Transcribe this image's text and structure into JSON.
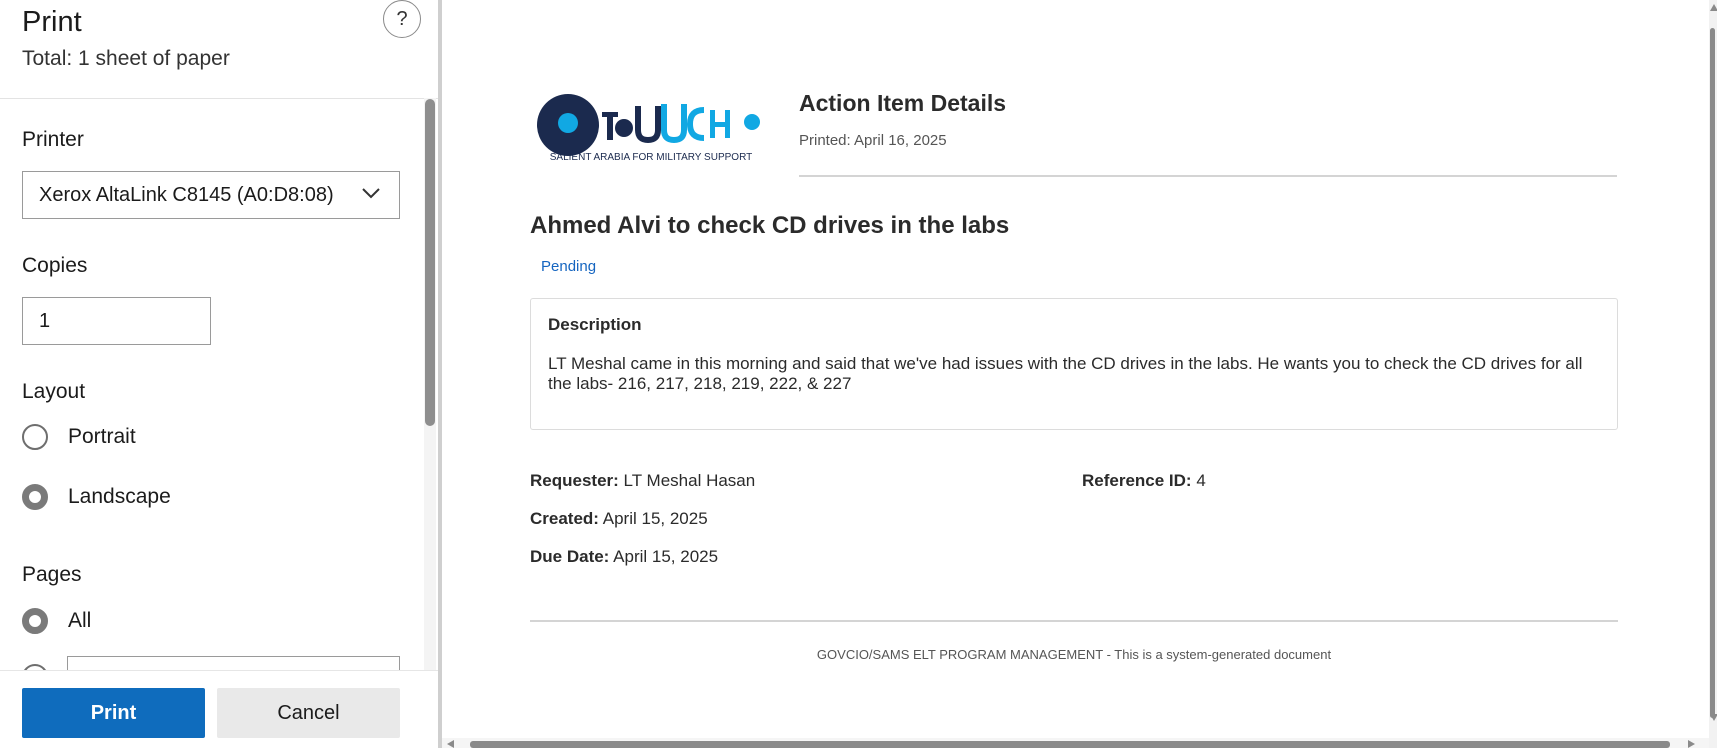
{
  "panel": {
    "title": "Print",
    "total": "Total: 1 sheet of paper",
    "help_glyph": "?",
    "printer": {
      "label": "Printer",
      "value": "Xerox AltaLink C8145 (A0:D8:08)"
    },
    "copies": {
      "label": "Copies",
      "value": "1"
    },
    "layout": {
      "label": "Layout",
      "options": [
        "Portrait",
        "Landscape"
      ],
      "selected": "Landscape"
    },
    "pages": {
      "label": "Pages",
      "options": [
        "All"
      ],
      "selected": "All"
    },
    "buttons": {
      "print": "Print",
      "cancel": "Cancel"
    }
  },
  "document": {
    "logo_caption": "SALIENT ARABIA FOR MILITARY SUPPORT",
    "header_title": "Action Item Details",
    "printed": "Printed: April 16, 2025",
    "item_title": "Ahmed Alvi to check CD drives in the labs",
    "status": "Pending",
    "description_heading": "Description",
    "description": "LT Meshal came in this morning and said that we've had issues with the CD drives in the labs. He wants you to check the CD drives for all the labs- 216, 217, 218, 219, 222, & 227",
    "fields": {
      "requester_label": "Requester:",
      "requester_value": "LT Meshal Hasan",
      "reference_label": "Reference ID:",
      "reference_value": "4",
      "created_label": "Created:",
      "created_value": "April 15, 2025",
      "due_label": "Due Date:",
      "due_value": "April 15, 2025"
    },
    "footer": "GOVCIO/SAMS ELT PROGRAM MANAGEMENT - This is a system-generated document"
  },
  "colors": {
    "accent": "#0f6cbd",
    "status": "#1565c0",
    "logo_dark": "#1b2a4e",
    "logo_light": "#11a8e3"
  }
}
